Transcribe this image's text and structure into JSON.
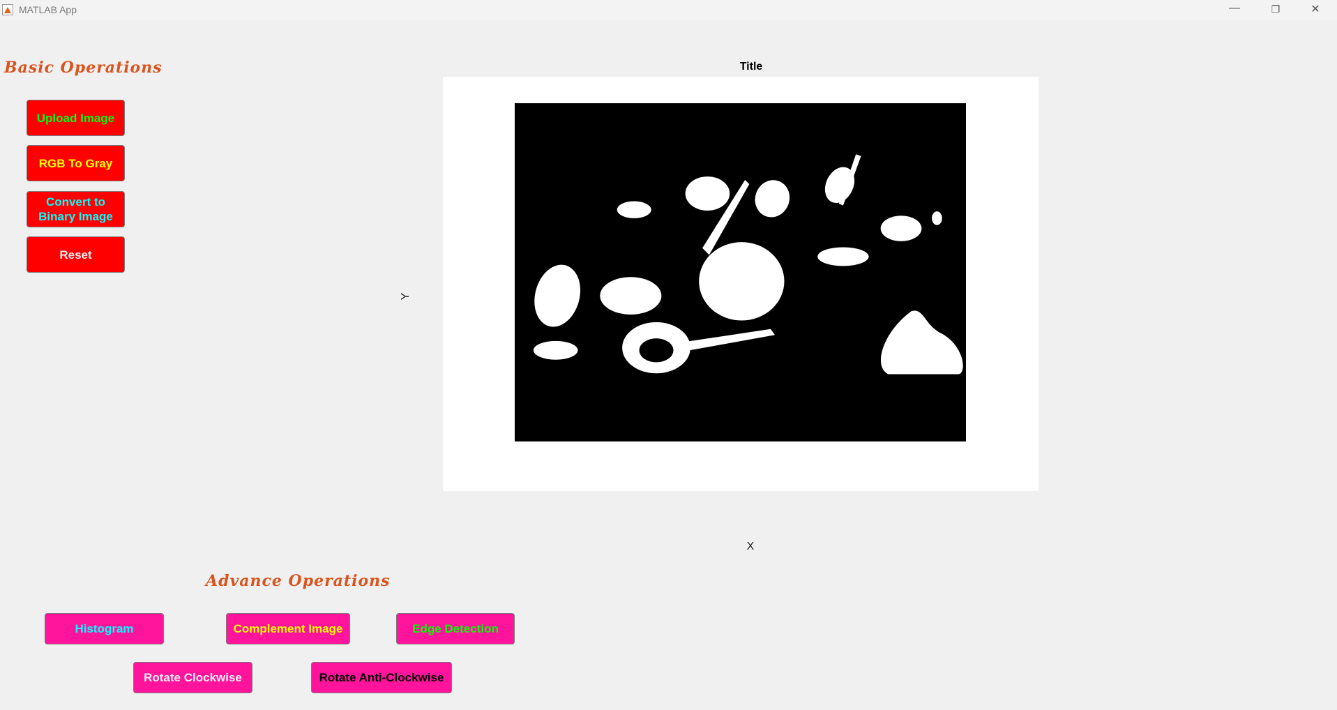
{
  "window": {
    "title": "MATLAB App",
    "minimize_icon": "minimize-icon",
    "restore_icon": "restore-icon",
    "close_icon": "close-icon"
  },
  "basic": {
    "title": "Basic Operations",
    "buttons": [
      {
        "label": "Upload Image",
        "color": "#00ff00"
      },
      {
        "label": "RGB To Gray",
        "color": "#ffff00"
      },
      {
        "label": "Convert to Binary Image",
        "color": "#00ffff"
      },
      {
        "label": "Reset",
        "color": "#f0f0f0"
      }
    ]
  },
  "axes": {
    "title": "Title",
    "xlabel": "X",
    "ylabel": "Y"
  },
  "advance": {
    "title": "Advance Operations",
    "buttons": [
      {
        "label": "Histogram",
        "color": "#00ffff"
      },
      {
        "label": "Complement Image",
        "color": "#ffff00"
      },
      {
        "label": "Edge Detection",
        "color": "#00ff00"
      },
      {
        "label": "Rotate Clockwise",
        "color": "#f0f0f0"
      },
      {
        "label": "Rotate Anti-Clockwise",
        "color": "#000000"
      }
    ]
  },
  "colors": {
    "basic_button_bg": "#ff0000",
    "advance_button_bg": "#ff149b",
    "section_title": "#d9541e"
  }
}
